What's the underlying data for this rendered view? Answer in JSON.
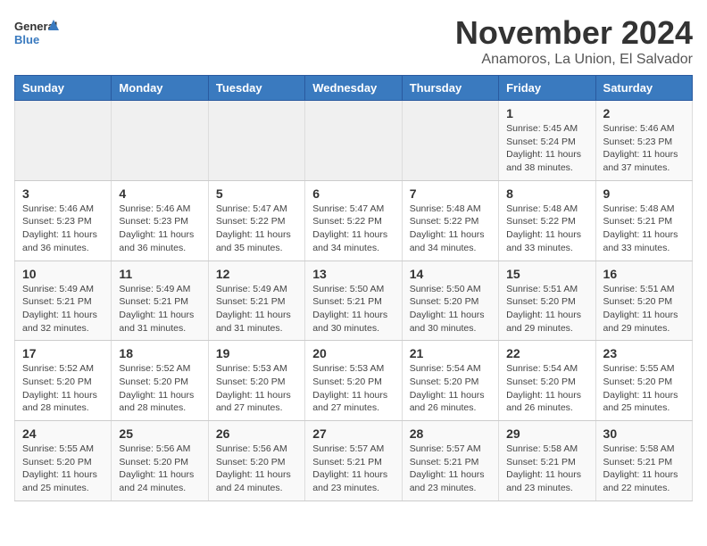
{
  "header": {
    "logo_general": "General",
    "logo_blue": "Blue",
    "month_year": "November 2024",
    "location": "Anamoros, La Union, El Salvador"
  },
  "weekdays": [
    "Sunday",
    "Monday",
    "Tuesday",
    "Wednesday",
    "Thursday",
    "Friday",
    "Saturday"
  ],
  "weeks": [
    [
      {
        "day": "",
        "info": ""
      },
      {
        "day": "",
        "info": ""
      },
      {
        "day": "",
        "info": ""
      },
      {
        "day": "",
        "info": ""
      },
      {
        "day": "",
        "info": ""
      },
      {
        "day": "1",
        "info": "Sunrise: 5:45 AM\nSunset: 5:24 PM\nDaylight: 11 hours\nand 38 minutes."
      },
      {
        "day": "2",
        "info": "Sunrise: 5:46 AM\nSunset: 5:23 PM\nDaylight: 11 hours\nand 37 minutes."
      }
    ],
    [
      {
        "day": "3",
        "info": "Sunrise: 5:46 AM\nSunset: 5:23 PM\nDaylight: 11 hours\nand 36 minutes."
      },
      {
        "day": "4",
        "info": "Sunrise: 5:46 AM\nSunset: 5:23 PM\nDaylight: 11 hours\nand 36 minutes."
      },
      {
        "day": "5",
        "info": "Sunrise: 5:47 AM\nSunset: 5:22 PM\nDaylight: 11 hours\nand 35 minutes."
      },
      {
        "day": "6",
        "info": "Sunrise: 5:47 AM\nSunset: 5:22 PM\nDaylight: 11 hours\nand 34 minutes."
      },
      {
        "day": "7",
        "info": "Sunrise: 5:48 AM\nSunset: 5:22 PM\nDaylight: 11 hours\nand 34 minutes."
      },
      {
        "day": "8",
        "info": "Sunrise: 5:48 AM\nSunset: 5:22 PM\nDaylight: 11 hours\nand 33 minutes."
      },
      {
        "day": "9",
        "info": "Sunrise: 5:48 AM\nSunset: 5:21 PM\nDaylight: 11 hours\nand 33 minutes."
      }
    ],
    [
      {
        "day": "10",
        "info": "Sunrise: 5:49 AM\nSunset: 5:21 PM\nDaylight: 11 hours\nand 32 minutes."
      },
      {
        "day": "11",
        "info": "Sunrise: 5:49 AM\nSunset: 5:21 PM\nDaylight: 11 hours\nand 31 minutes."
      },
      {
        "day": "12",
        "info": "Sunrise: 5:49 AM\nSunset: 5:21 PM\nDaylight: 11 hours\nand 31 minutes."
      },
      {
        "day": "13",
        "info": "Sunrise: 5:50 AM\nSunset: 5:21 PM\nDaylight: 11 hours\nand 30 minutes."
      },
      {
        "day": "14",
        "info": "Sunrise: 5:50 AM\nSunset: 5:20 PM\nDaylight: 11 hours\nand 30 minutes."
      },
      {
        "day": "15",
        "info": "Sunrise: 5:51 AM\nSunset: 5:20 PM\nDaylight: 11 hours\nand 29 minutes."
      },
      {
        "day": "16",
        "info": "Sunrise: 5:51 AM\nSunset: 5:20 PM\nDaylight: 11 hours\nand 29 minutes."
      }
    ],
    [
      {
        "day": "17",
        "info": "Sunrise: 5:52 AM\nSunset: 5:20 PM\nDaylight: 11 hours\nand 28 minutes."
      },
      {
        "day": "18",
        "info": "Sunrise: 5:52 AM\nSunset: 5:20 PM\nDaylight: 11 hours\nand 28 minutes."
      },
      {
        "day": "19",
        "info": "Sunrise: 5:53 AM\nSunset: 5:20 PM\nDaylight: 11 hours\nand 27 minutes."
      },
      {
        "day": "20",
        "info": "Sunrise: 5:53 AM\nSunset: 5:20 PM\nDaylight: 11 hours\nand 27 minutes."
      },
      {
        "day": "21",
        "info": "Sunrise: 5:54 AM\nSunset: 5:20 PM\nDaylight: 11 hours\nand 26 minutes."
      },
      {
        "day": "22",
        "info": "Sunrise: 5:54 AM\nSunset: 5:20 PM\nDaylight: 11 hours\nand 26 minutes."
      },
      {
        "day": "23",
        "info": "Sunrise: 5:55 AM\nSunset: 5:20 PM\nDaylight: 11 hours\nand 25 minutes."
      }
    ],
    [
      {
        "day": "24",
        "info": "Sunrise: 5:55 AM\nSunset: 5:20 PM\nDaylight: 11 hours\nand 25 minutes."
      },
      {
        "day": "25",
        "info": "Sunrise: 5:56 AM\nSunset: 5:20 PM\nDaylight: 11 hours\nand 24 minutes."
      },
      {
        "day": "26",
        "info": "Sunrise: 5:56 AM\nSunset: 5:20 PM\nDaylight: 11 hours\nand 24 minutes."
      },
      {
        "day": "27",
        "info": "Sunrise: 5:57 AM\nSunset: 5:21 PM\nDaylight: 11 hours\nand 23 minutes."
      },
      {
        "day": "28",
        "info": "Sunrise: 5:57 AM\nSunset: 5:21 PM\nDaylight: 11 hours\nand 23 minutes."
      },
      {
        "day": "29",
        "info": "Sunrise: 5:58 AM\nSunset: 5:21 PM\nDaylight: 11 hours\nand 23 minutes."
      },
      {
        "day": "30",
        "info": "Sunrise: 5:58 AM\nSunset: 5:21 PM\nDaylight: 11 hours\nand 22 minutes."
      }
    ]
  ]
}
